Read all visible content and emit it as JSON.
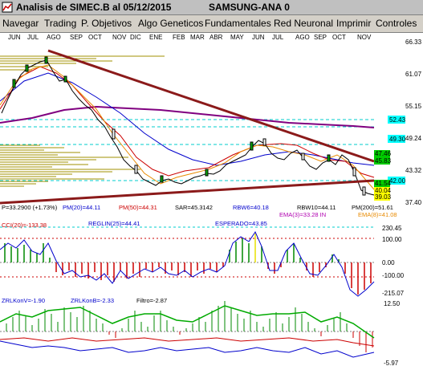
{
  "window": {
    "title": "Analisis de SIMEC.B al 05/12/2015",
    "symbol": "SAMSUNG-ANA 0"
  },
  "menu": [
    "Navegar",
    "Trading",
    "P. Objetivos",
    "Algo Geneticos",
    "Fundamentales",
    "Red Neuronal",
    "Imprimir",
    "Controles"
  ],
  "months": [
    "JUN",
    "JUL",
    "AGO",
    "SEP",
    "OCT",
    "NOV",
    "DIC",
    "ENE",
    "FEB",
    "MAR",
    "ABR",
    "MAY",
    "JUN",
    "JUL",
    "AGO",
    "SEP",
    "OCT",
    "NOV"
  ],
  "price_panel": {
    "axis_labels": [
      "66.33",
      "61.07",
      "55.15",
      "49.24",
      "43.32",
      "37.40"
    ],
    "level_tags": [
      "52.43",
      "49.30",
      "47.46",
      "45.83",
      "42.00",
      "41.54",
      "40.04",
      "39.03"
    ],
    "readout_line1": [
      "P=33.2900 (+1.73%)",
      "PM(20)=44.11",
      "PM(50)=44.31",
      "SAR=45.3142",
      "RBW6=40.18",
      "RBW10=44.11",
      "PM(200)=51.61"
    ],
    "readout_line2": [
      "EMA(3)=33.28 IN",
      "EMA(8)=41.08"
    ]
  },
  "cci_panel": {
    "labels": [
      "CCI(20)=-133.38",
      "REGLIN(25)=44.41",
      "ESPERADO=43.85"
    ],
    "axis_labels": [
      "230.45",
      "100.00",
      "0.00",
      "-100.00",
      "-215.07"
    ]
  },
  "zrl_panel": {
    "labels": [
      "ZRLKonV=-1.90",
      "ZRLKonB=-2.33",
      "Filtro=-2.87"
    ],
    "axis_labels": [
      "12.50",
      "-5.97"
    ]
  },
  "colors": {
    "trend_line": "#8b1a1a",
    "ma200": "#800080",
    "ma50": "#0000cc",
    "ema_orange": "#e88a00",
    "ma20": "#cc0000",
    "tag_cyan": "#00ffff",
    "tag_green": "#00cc00",
    "tag_yellow": "#ffff00"
  }
}
